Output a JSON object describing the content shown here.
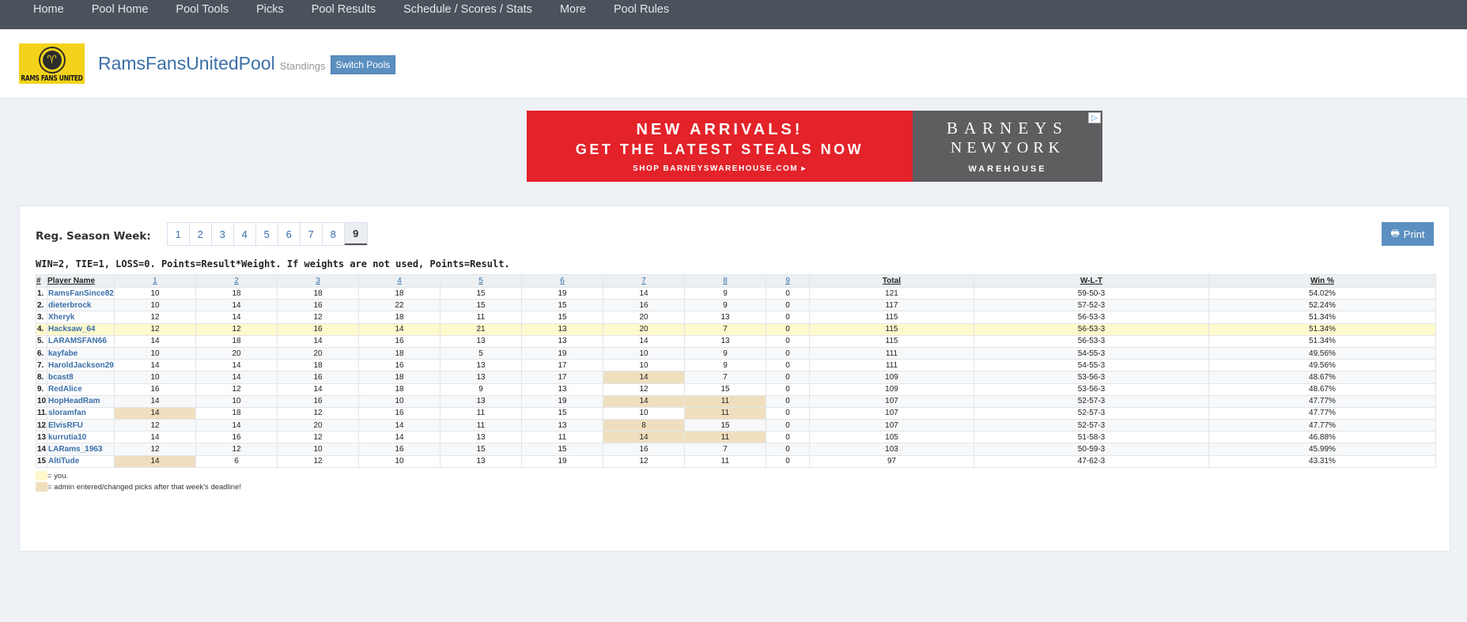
{
  "nav": [
    "Home",
    "Pool Home",
    "Pool Tools",
    "Picks",
    "Pool Results",
    "Schedule / Scores / Stats",
    "More",
    "Pool Rules"
  ],
  "header": {
    "logo_text": "RAMS FANS UNITED",
    "pool_name": "RamsFansUnitedPool",
    "page_name": "Standings",
    "switch_label": "Switch Pools"
  },
  "ad": {
    "line1": "NEW ARRIVALS!",
    "line2": "GET THE LATEST STEALS NOW",
    "line3": "SHOP BARNEYSWAREHOUSE.COM ▸",
    "brand1": "BARNEYS",
    "brand2": "NEWYORK",
    "brand3": "WAREHOUSE"
  },
  "week_label": "Reg. Season Week:",
  "weeks": [
    "1",
    "2",
    "3",
    "4",
    "5",
    "6",
    "7",
    "8",
    "9"
  ],
  "active_week": "9",
  "print_label": "Print",
  "rules_text": "WIN=2, TIE=1, LOSS=0. Points=Result*Weight. If weights are not used, Points=Result.",
  "table": {
    "headers": [
      "#",
      "Player Name",
      "1",
      "2",
      "3",
      "4",
      "5",
      "6",
      "7",
      "8",
      "9",
      "Total",
      "W-L-T",
      "Win %"
    ],
    "rows": [
      {
        "rank": "1.",
        "name": "RamsFanSince82",
        "weeks": [
          "10",
          "18",
          "18",
          "18",
          "15",
          "19",
          "14",
          "9",
          "0"
        ],
        "total": "121",
        "wlt": "59-50-3",
        "pct": "54.02%",
        "admin": []
      },
      {
        "rank": "2.",
        "name": "dieterbrock",
        "weeks": [
          "10",
          "14",
          "16",
          "22",
          "15",
          "15",
          "16",
          "9",
          "0"
        ],
        "total": "117",
        "wlt": "57-52-3",
        "pct": "52.24%",
        "admin": []
      },
      {
        "rank": "3.",
        "name": "Xheryk",
        "weeks": [
          "12",
          "14",
          "12",
          "18",
          "11",
          "15",
          "20",
          "13",
          "0"
        ],
        "total": "115",
        "wlt": "56-53-3",
        "pct": "51.34%",
        "admin": []
      },
      {
        "rank": "4.",
        "name": "Hacksaw_64",
        "weeks": [
          "12",
          "12",
          "16",
          "14",
          "21",
          "13",
          "20",
          "7",
          "0"
        ],
        "total": "115",
        "wlt": "56-53-3",
        "pct": "51.34%",
        "admin": [],
        "me": true
      },
      {
        "rank": "5.",
        "name": "LARAMSFAN66",
        "weeks": [
          "14",
          "18",
          "14",
          "16",
          "13",
          "13",
          "14",
          "13",
          "0"
        ],
        "total": "115",
        "wlt": "56-53-3",
        "pct": "51.34%",
        "admin": []
      },
      {
        "rank": "6.",
        "name": "kayfabe",
        "weeks": [
          "10",
          "20",
          "20",
          "18",
          "5",
          "19",
          "10",
          "9",
          "0"
        ],
        "total": "111",
        "wlt": "54-55-3",
        "pct": "49.56%",
        "admin": []
      },
      {
        "rank": "7.",
        "name": "HaroldJackson29",
        "weeks": [
          "14",
          "14",
          "18",
          "16",
          "13",
          "17",
          "10",
          "9",
          "0"
        ],
        "total": "111",
        "wlt": "54-55-3",
        "pct": "49.56%",
        "admin": []
      },
      {
        "rank": "8.",
        "name": "bcast8",
        "weeks": [
          "10",
          "14",
          "16",
          "18",
          "13",
          "17",
          "14",
          "7",
          "0"
        ],
        "total": "109",
        "wlt": "53-56-3",
        "pct": "48.67%",
        "admin": [
          6
        ]
      },
      {
        "rank": "9.",
        "name": "RedAlice",
        "weeks": [
          "16",
          "12",
          "14",
          "18",
          "9",
          "13",
          "12",
          "15",
          "0"
        ],
        "total": "109",
        "wlt": "53-56-3",
        "pct": "48.67%",
        "admin": []
      },
      {
        "rank": "10.",
        "name": "HopHeadRam",
        "weeks": [
          "14",
          "10",
          "16",
          "10",
          "13",
          "19",
          "14",
          "11",
          "0"
        ],
        "total": "107",
        "wlt": "52-57-3",
        "pct": "47.77%",
        "admin": [
          6,
          7
        ]
      },
      {
        "rank": "11.",
        "name": "sloramfan",
        "weeks": [
          "14",
          "18",
          "12",
          "16",
          "11",
          "15",
          "10",
          "11",
          "0"
        ],
        "total": "107",
        "wlt": "52-57-3",
        "pct": "47.77%",
        "admin": [
          0,
          7
        ]
      },
      {
        "rank": "12.",
        "name": "ElvisRFU",
        "weeks": [
          "12",
          "14",
          "20",
          "14",
          "11",
          "13",
          "8",
          "15",
          "0"
        ],
        "total": "107",
        "wlt": "52-57-3",
        "pct": "47.77%",
        "admin": [
          6
        ]
      },
      {
        "rank": "13.",
        "name": "kurrutia10",
        "weeks": [
          "14",
          "16",
          "12",
          "14",
          "13",
          "11",
          "14",
          "11",
          "0"
        ],
        "total": "105",
        "wlt": "51-58-3",
        "pct": "46.88%",
        "admin": [
          6,
          7
        ]
      },
      {
        "rank": "14.",
        "name": "LARams_1963",
        "weeks": [
          "12",
          "12",
          "10",
          "16",
          "15",
          "15",
          "16",
          "7",
          "0"
        ],
        "total": "103",
        "wlt": "50-59-3",
        "pct": "45.99%",
        "admin": []
      },
      {
        "rank": "15.",
        "name": "AltiTude",
        "weeks": [
          "14",
          "6",
          "12",
          "10",
          "13",
          "19",
          "12",
          "11",
          "0"
        ],
        "total": "97",
        "wlt": "47-62-3",
        "pct": "43.31%",
        "admin": [
          0
        ]
      }
    ]
  },
  "legend": {
    "you": "= you.",
    "admin": "= admin entered/changed picks after that week's deadline!"
  },
  "colors": {
    "nav_bg": "#4a525c",
    "accent": "#3a6fa8",
    "button": "#5b8fc0",
    "you_highlight": "#fffacd",
    "admin_highlight": "#f0dfbf"
  }
}
